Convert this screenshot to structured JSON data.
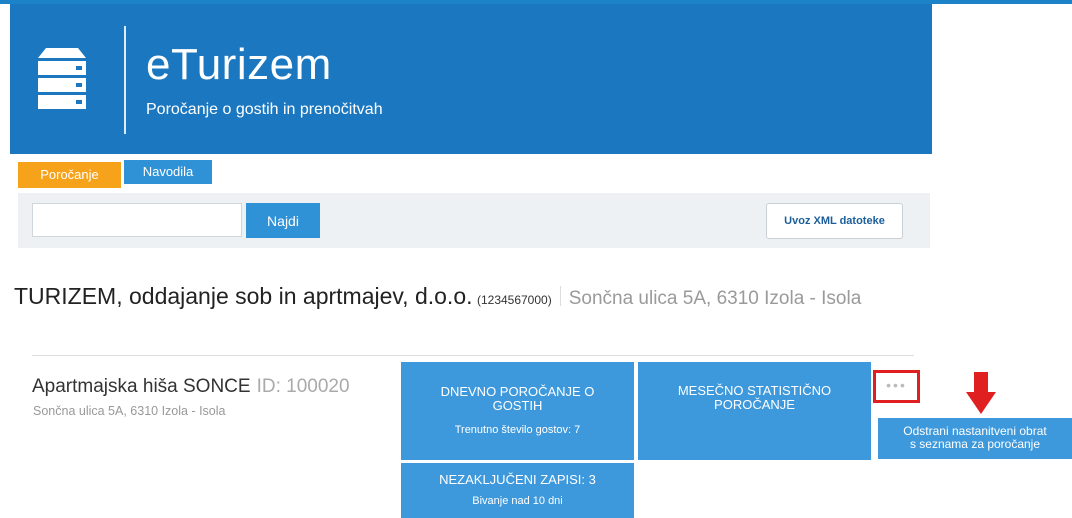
{
  "header": {
    "title": "eTurizem",
    "subtitle": "Poročanje o gostih in prenočitvah",
    "logo_icon": "server-stack-icon",
    "background_color": "#1b78c0"
  },
  "tabs": [
    {
      "label": "Poročanje",
      "active": true,
      "color": "#f7a21b"
    },
    {
      "label": "Navodila",
      "active": false,
      "color": "#2f92d6"
    }
  ],
  "search": {
    "value": "",
    "placeholder": "",
    "button_label": "Najdi"
  },
  "import_button_label": "Uvoz XML datoteke",
  "company": {
    "name": "TURIZEM, oddajanje sob in aprtmajev, d.o.o.",
    "id": "(1234567000)",
    "address": "Sončna ulica 5A, 6310 Izola - Isola"
  },
  "facility": {
    "name": "Apartmajska hiša SONCE",
    "id": "ID: 100020",
    "address": "Sončna ulica 5A, 6310 Izola - Isola"
  },
  "tiles": {
    "daily": {
      "title": "DNEVNO POROČANJE O GOSTIH",
      "subtitle": "Trenutno število gostov: 7"
    },
    "monthly": {
      "title": "MESEČNO STATISTIČNO POROČANJE"
    },
    "open_records": {
      "title": "NEZAKLJUČENI ZAPISI: 3",
      "subtitle": "Bivanje nad 10 dni"
    }
  },
  "more_button": {
    "icon": "more-dots-icon",
    "glyph": "•••",
    "highlight_color": "#e02020"
  },
  "annotation_arrow": {
    "icon": "arrow-down-icon",
    "color": "#e02020"
  },
  "remove_button_label": "Odstrani nastanitveni obrat\ns seznama za poročanje"
}
